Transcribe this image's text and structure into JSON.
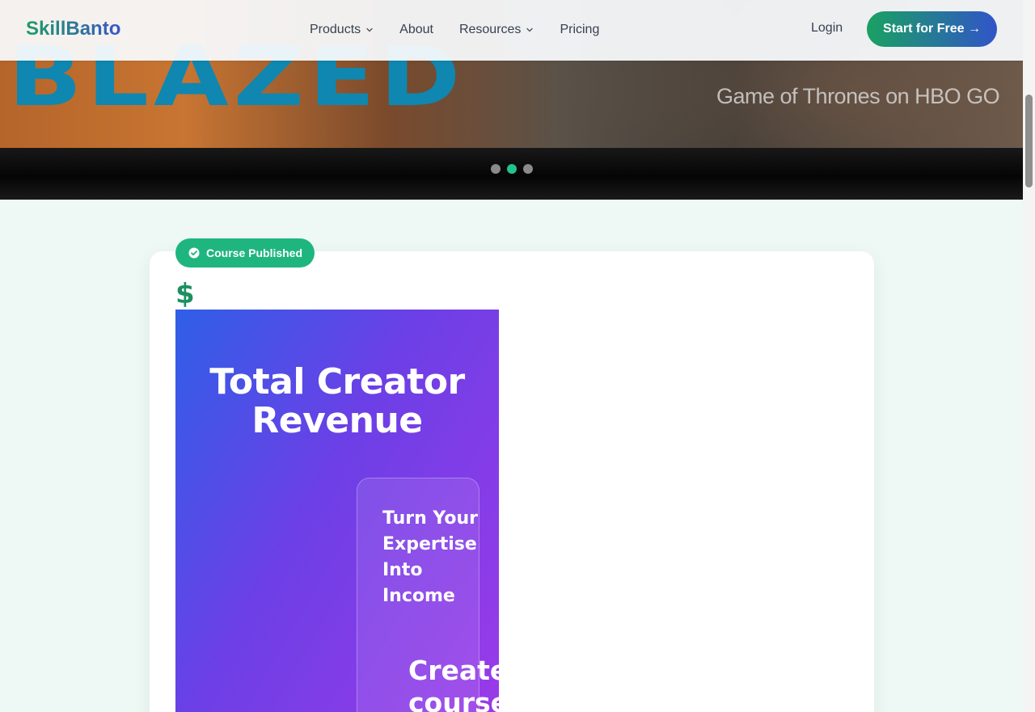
{
  "navbar": {
    "brand": "SkillBanto",
    "links": [
      {
        "label": "Products",
        "has_dropdown": true
      },
      {
        "label": "About",
        "has_dropdown": false
      },
      {
        "label": "Resources",
        "has_dropdown": true
      },
      {
        "label": "Pricing",
        "has_dropdown": false
      }
    ],
    "login_label": "Login",
    "cta_label": "Start for Free →"
  },
  "hero": {
    "image_caption": "Game of Thrones on HBO GO",
    "image_logo_text": "BLAZED",
    "slides_total": 3,
    "active_slide": 2
  },
  "card": {
    "badge_label": "Course Published",
    "currency_symbol": "$",
    "panel_title": "Total Creator Revenue",
    "panel_subtitle": "Turn Your Expertise Into Income",
    "panel_cta_text": "Create course"
  },
  "colors": {
    "accent_green": "#1fb57f",
    "brand_blue": "#3154c8",
    "dot_active": "#22c38e",
    "panel_gradient_start": "#2f5fe6",
    "panel_gradient_end": "#9a3ae8"
  }
}
